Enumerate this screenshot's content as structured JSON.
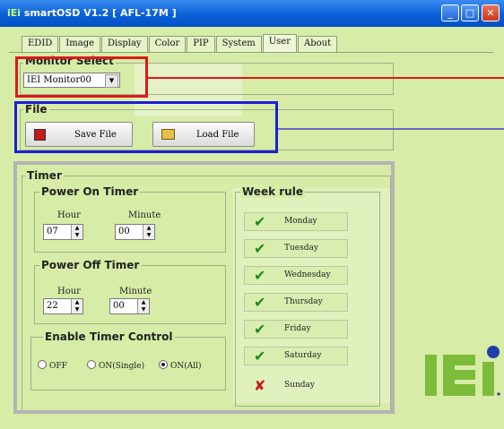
{
  "window": {
    "title": "smartOSD V1.2 [ AFL-17M ]",
    "title_icon": "iei-small-logo"
  },
  "tabs": [
    "EDID",
    "Image",
    "Display",
    "Color",
    "PIP",
    "System",
    "User",
    "About"
  ],
  "active_tab": "User",
  "monitor_select": {
    "label": "Monitor Select",
    "selected": "IEI Monitor00"
  },
  "file": {
    "label": "File",
    "save_label": "Save File",
    "load_label": "Load File"
  },
  "timer": {
    "label": "Timer",
    "power_on": {
      "label": "Power On Timer",
      "hour_label": "Hour",
      "minute_label": "Minute",
      "hour": "07",
      "minute": "00"
    },
    "power_off": {
      "label": "Power Off Timer",
      "hour_label": "Hour",
      "minute_label": "Minute",
      "hour": "22",
      "minute": "00"
    },
    "enable": {
      "label": "Enable Timer Control",
      "options": [
        "OFF",
        "ON(Single)",
        "ON(All)"
      ],
      "selected": "ON(All)"
    },
    "week_rule": {
      "label": "Week rule",
      "days": [
        {
          "name": "Monday",
          "checked": true
        },
        {
          "name": "Tuesday",
          "checked": true
        },
        {
          "name": "Wednesday",
          "checked": true
        },
        {
          "name": "Thursday",
          "checked": true
        },
        {
          "name": "Friday",
          "checked": true
        },
        {
          "name": "Saturday",
          "checked": true
        },
        {
          "name": "Sunday",
          "checked": false
        }
      ]
    }
  },
  "logo_text": "iEi",
  "colors": {
    "title_bar": "#0a5fd8",
    "panel_bg": "#d7eca7",
    "highlight_red": "#e01818",
    "highlight_blue": "#1d1dd8",
    "highlight_grey": "#b4b4b4",
    "check_green": "#1e8a1e",
    "cross_red": "#c81818",
    "logo_green": "#7dbb3a",
    "logo_blue": "#1f3fa8"
  }
}
